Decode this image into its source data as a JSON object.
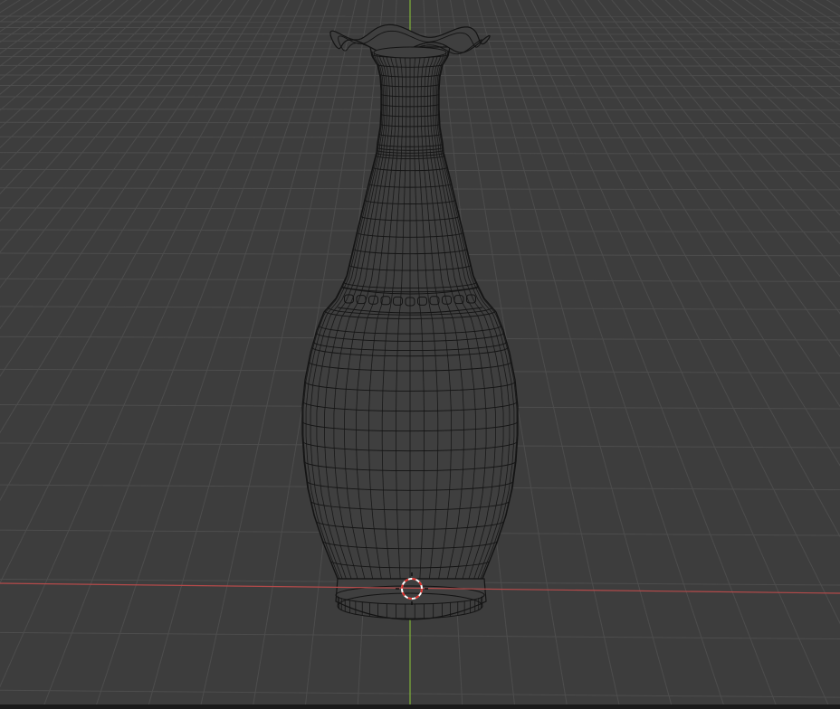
{
  "viewport": {
    "view": "3D Viewport",
    "shading": "wireframe",
    "background_color": "#3d3d3d",
    "grid_color": "#4d4d4d",
    "x_axis_color": "#b44a4a",
    "y_axis_color": "#7fb03a",
    "cursor_colors": [
      "#ffffff",
      "#e0302c"
    ]
  },
  "object": {
    "name_icon": "vase-mesh",
    "wire_color": "#141414",
    "fill_color": "#3f3f3f"
  }
}
